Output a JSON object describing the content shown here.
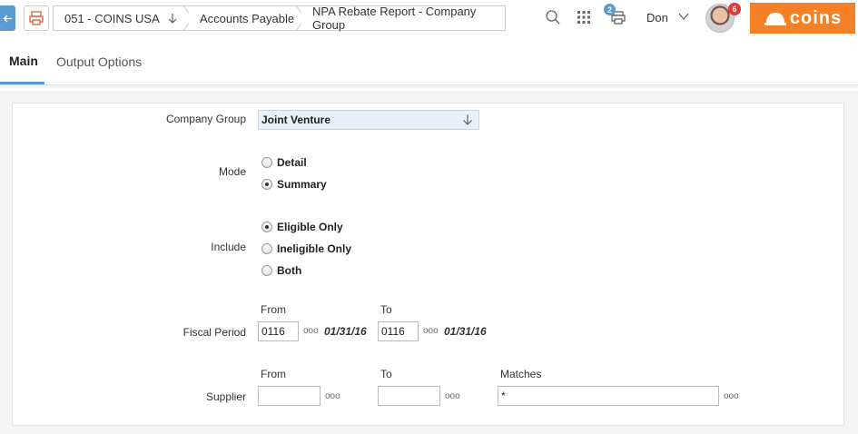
{
  "header": {
    "breadcrumbs": [
      "051 - COINS USA",
      "Accounts Payable",
      "NPA Rebate Report - Company Group"
    ],
    "print_queue_count": "2",
    "user_name": "Don",
    "notification_count": "6",
    "logo_text": "coins",
    "accent_color": "#5b9bd5",
    "brand_color": "#f58025"
  },
  "tabs": [
    {
      "label": "Main",
      "active": true
    },
    {
      "label": "Output Options",
      "active": false
    }
  ],
  "form": {
    "company_group": {
      "label": "Company Group",
      "value": "Joint Venture"
    },
    "mode": {
      "label": "Mode",
      "options": [
        {
          "label": "Detail",
          "checked": false
        },
        {
          "label": "Summary",
          "checked": true
        }
      ]
    },
    "include": {
      "label": "Include",
      "options": [
        {
          "label": "Eligible Only",
          "checked": true
        },
        {
          "label": "Ineligible Only",
          "checked": false
        },
        {
          "label": "Both",
          "checked": false
        }
      ]
    },
    "fiscal_period": {
      "label": "Fiscal Period",
      "from_label": "From",
      "to_label": "To",
      "from_value": "0116",
      "from_date": "01/31/16",
      "to_value": "0116",
      "to_date": "01/31/16"
    },
    "supplier": {
      "label": "Supplier",
      "from_label": "From",
      "to_label": "To",
      "matches_label": "Matches",
      "from_value": "",
      "to_value": "",
      "matches_value": "*"
    },
    "ellipsis": "ooo"
  }
}
